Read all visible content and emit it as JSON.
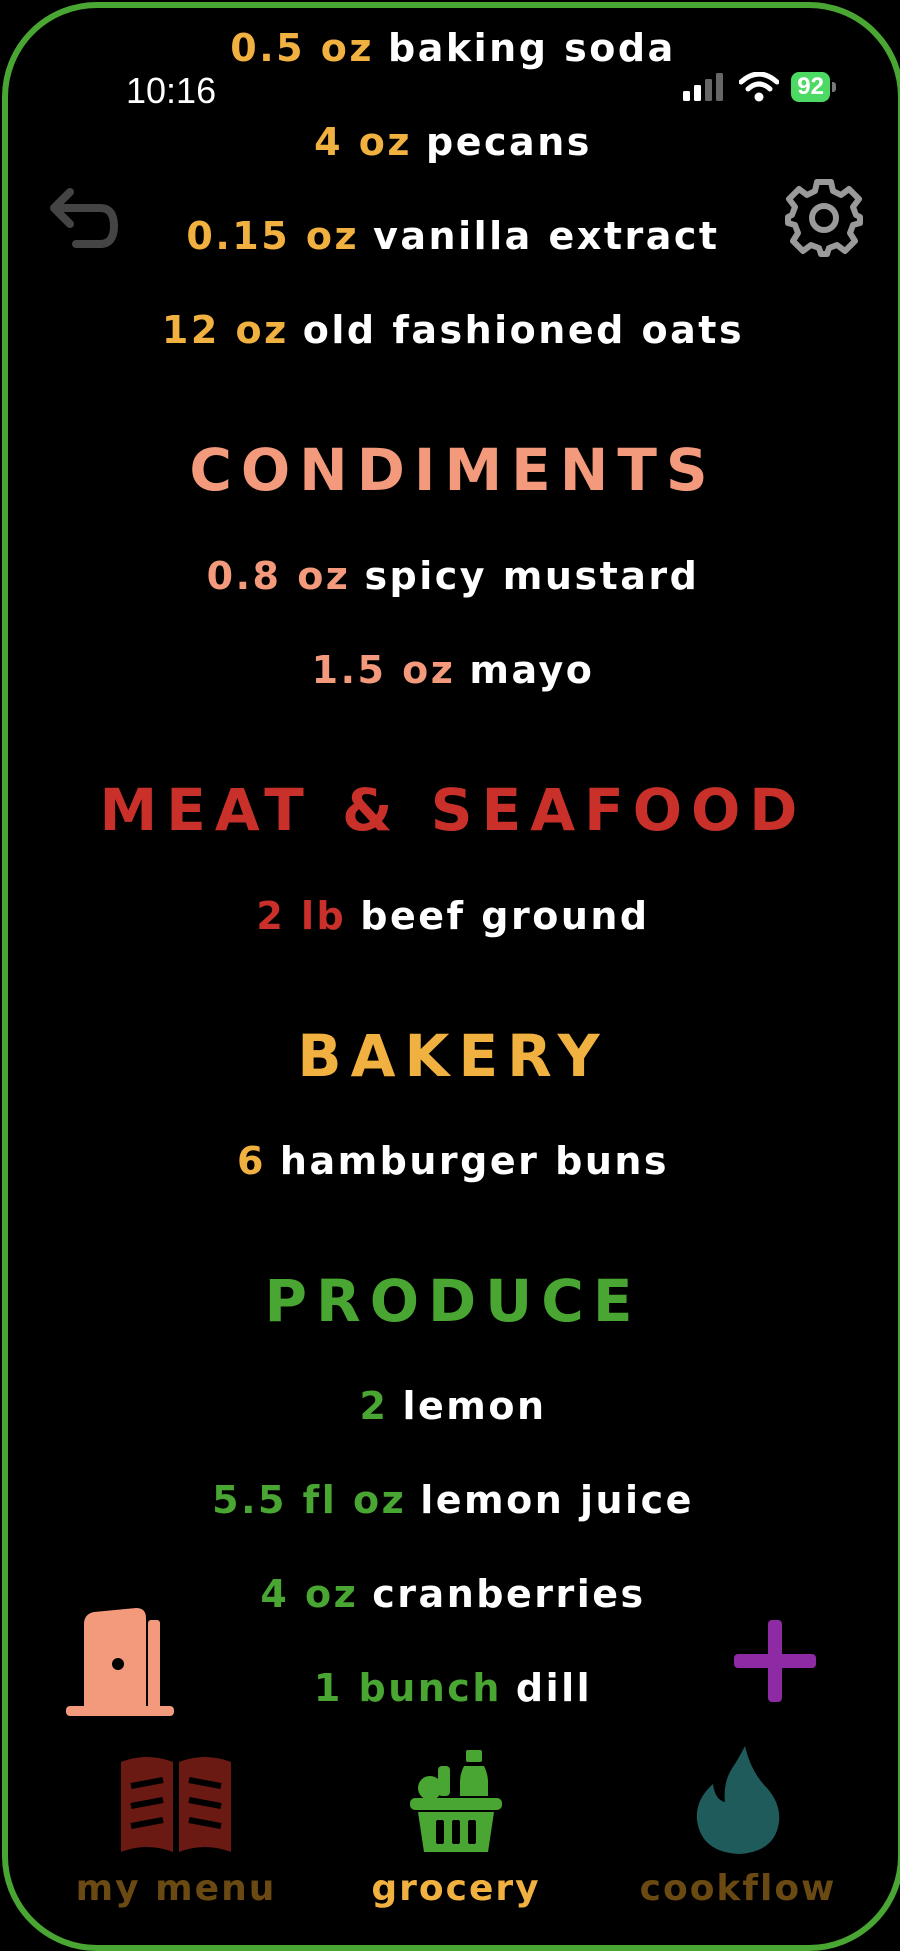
{
  "status_bar": {
    "time": "10:16",
    "battery": "92"
  },
  "colors": {
    "frame": "#4aa632",
    "baking": "#f1b140",
    "condiments": "#f29a7b",
    "meat": "#c9302a",
    "bakery": "#f1b140",
    "produce": "#4aa632",
    "nav_menu": "#6a1a12",
    "nav_grocery": "#4aa632",
    "nav_cookflow": "#1f5b5b",
    "add": "#8e2aa3"
  },
  "sections": [
    {
      "key": "baking",
      "heading": "",
      "items": [
        {
          "qty": "0.5 oz",
          "name": "baking soda"
        },
        {
          "qty": "4 oz",
          "name": "pecans"
        },
        {
          "qty": "0.15 oz",
          "name": "vanilla extract"
        },
        {
          "qty": "12 oz",
          "name": "old fashioned oats"
        }
      ]
    },
    {
      "key": "condiments",
      "heading": "CONDIMENTS",
      "items": [
        {
          "qty": "0.8 oz",
          "name": "spicy mustard"
        },
        {
          "qty": "1.5 oz",
          "name": "mayo"
        }
      ]
    },
    {
      "key": "meat",
      "heading": "MEAT & SEAFOOD",
      "items": [
        {
          "qty": "2 lb",
          "name": "beef ground"
        }
      ]
    },
    {
      "key": "bakery",
      "heading": "BAKERY",
      "items": [
        {
          "qty": "6",
          "name": "hamburger buns"
        }
      ]
    },
    {
      "key": "produce",
      "heading": "PRODUCE",
      "items": [
        {
          "qty": "2",
          "name": "lemon"
        },
        {
          "qty": "5.5 fl oz",
          "name": "lemon juice"
        },
        {
          "qty": "4 oz",
          "name": "cranberries"
        },
        {
          "qty": "1 bunch",
          "name": "dill"
        }
      ]
    }
  ],
  "nav": {
    "my_menu": "my menu",
    "grocery": "grocery",
    "cookflow": "cookflow"
  },
  "icons": {
    "undo": "undo-icon",
    "settings": "gear-icon",
    "exit": "door-exit-icon",
    "add": "plus-icon"
  }
}
